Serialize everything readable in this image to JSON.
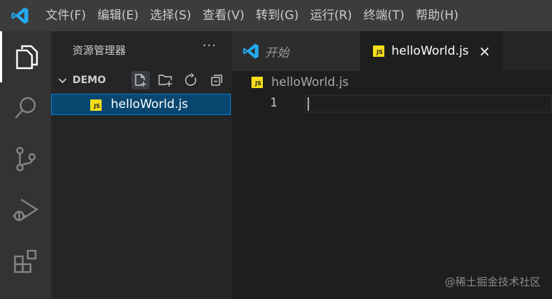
{
  "titlebar": {
    "menu": [
      {
        "label": "文件(F)"
      },
      {
        "label": "编辑(E)"
      },
      {
        "label": "选择(S)"
      },
      {
        "label": "查看(V)"
      },
      {
        "label": "转到(G)"
      },
      {
        "label": "运行(R)"
      },
      {
        "label": "终端(T)"
      },
      {
        "label": "帮助(H)"
      }
    ]
  },
  "activitybar": {
    "items": [
      {
        "icon": "explorer-icon",
        "active": true
      },
      {
        "icon": "search-icon"
      },
      {
        "icon": "source-control-icon"
      },
      {
        "icon": "run-debug-icon"
      },
      {
        "icon": "extensions-icon"
      }
    ]
  },
  "sidebar": {
    "title": "资源管理器",
    "more": "···",
    "folder": {
      "label": "DEMO",
      "actions": [
        "new-file-icon",
        "new-folder-icon",
        "refresh-icon",
        "collapse-all-icon"
      ]
    },
    "files": [
      {
        "icon_text": "JS",
        "name": "helloWorld.js",
        "selected": true
      }
    ]
  },
  "tabs": {
    "welcome": {
      "label": "开始"
    },
    "file": {
      "icon_text": "JS",
      "label": "helloWorld.js",
      "close": "×"
    }
  },
  "breadcrumb": {
    "icon_text": "JS",
    "label": "helloWorld.js"
  },
  "editor": {
    "line_number": "1"
  },
  "watermark": "@稀土掘金技术社区",
  "colors": {
    "accent": "#007acc",
    "selection": "#094771",
    "js_icon": "#f5de19",
    "vscode_blue": "#23a9f2"
  }
}
